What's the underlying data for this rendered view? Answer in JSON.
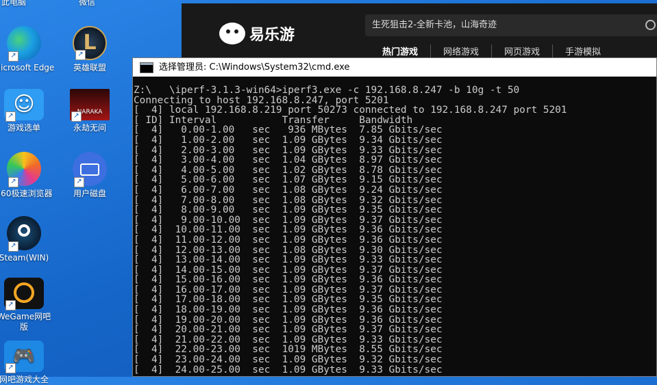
{
  "desktop": {
    "top_labels": [
      "此电脑",
      "微信"
    ],
    "icons": [
      {
        "name": "edge",
        "label": "Microsoft Edge",
        "color": "#0f8bd8"
      },
      {
        "name": "lol",
        "label": "英雄联盟",
        "color": "#1b2a3a"
      },
      {
        "name": "youxi",
        "label": "游戏选单",
        "color": "#2f9df4"
      },
      {
        "name": "yongjie",
        "label": "永劫无间",
        "color": "#8c1414"
      },
      {
        "name": "browser360",
        "label": "360极速浏览器",
        "color": "#e8e8e8"
      },
      {
        "name": "disk",
        "label": "用户磁盘",
        "color": "#3d6fe0"
      },
      {
        "name": "steam",
        "label": "Steam(WIN)",
        "color": "#0e2a44"
      },
      {
        "name": "vegame",
        "label": "WeGame网吧版",
        "color": "#111111"
      },
      {
        "name": "game",
        "label": "网吧游戏大全",
        "color": "#1e88e5"
      }
    ]
  },
  "browser": {
    "logo_text": "易乐游",
    "search_placeholder": "生死狙击2-全新卡池，山海奇迹",
    "nav": [
      "热门游戏",
      "网络游戏",
      "网页游戏",
      "手游模拟"
    ]
  },
  "cmd": {
    "title": "选择管理员: C:\\Windows\\System32\\cmd.exe",
    "lines": [
      "Z:\\   \\iperf-3.1.3-win64>iperf3.exe -c 192.168.8.247 -b 10g -t 50",
      "Connecting to host 192.168.8.247, port 5201",
      "[  4] local 192.168.8.219 port 50273 connected to 192.168.8.247 port 5201",
      "[ ID] Interval           Transfer     Bandwidth",
      "[  4]   0.00-1.00   sec   936 MBytes  7.85 Gbits/sec",
      "[  4]   1.00-2.00   sec  1.09 GBytes  9.34 Gbits/sec",
      "[  4]   2.00-3.00   sec  1.09 GBytes  9.33 Gbits/sec",
      "[  4]   3.00-4.00   sec  1.04 GBytes  8.97 Gbits/sec",
      "[  4]   4.00-5.00   sec  1.02 GBytes  8.78 Gbits/sec",
      "[  4]   5.00-6.00   sec  1.07 GBytes  9.15 Gbits/sec",
      "[  4]   6.00-7.00   sec  1.08 GBytes  9.24 Gbits/sec",
      "[  4]   7.00-8.00   sec  1.08 GBytes  9.32 Gbits/sec",
      "[  4]   8.00-9.00   sec  1.09 GBytes  9.35 Gbits/sec",
      "[  4]   9.00-10.00  sec  1.09 GBytes  9.37 Gbits/sec",
      "[  4]  10.00-11.00  sec  1.09 GBytes  9.36 Gbits/sec",
      "[  4]  11.00-12.00  sec  1.09 GBytes  9.36 Gbits/sec",
      "[  4]  12.00-13.00  sec  1.08 GBytes  9.30 Gbits/sec",
      "[  4]  13.00-14.00  sec  1.09 GBytes  9.33 Gbits/sec",
      "[  4]  14.00-15.00  sec  1.09 GBytes  9.37 Gbits/sec",
      "[  4]  15.00-16.00  sec  1.09 GBytes  9.36 Gbits/sec",
      "[  4]  16.00-17.00  sec  1.09 GBytes  9.37 Gbits/sec",
      "[  4]  17.00-18.00  sec  1.09 GBytes  9.35 Gbits/sec",
      "[  4]  18.00-19.00  sec  1.09 GBytes  9.36 Gbits/sec",
      "[  4]  19.00-20.00  sec  1.09 GBytes  9.36 Gbits/sec",
      "[  4]  20.00-21.00  sec  1.09 GBytes  9.37 Gbits/sec",
      "[  4]  21.00-22.00  sec  1.09 GBytes  9.33 Gbits/sec",
      "[  4]  22.00-23.00  sec  1019 MBytes  8.55 Gbits/sec",
      "[  4]  23.00-24.00  sec  1.09 GBytes  9.32 Gbits/sec",
      "[  4]  24.00-25.00  sec  1.09 GBytes  9.33 Gbits/sec"
    ]
  }
}
